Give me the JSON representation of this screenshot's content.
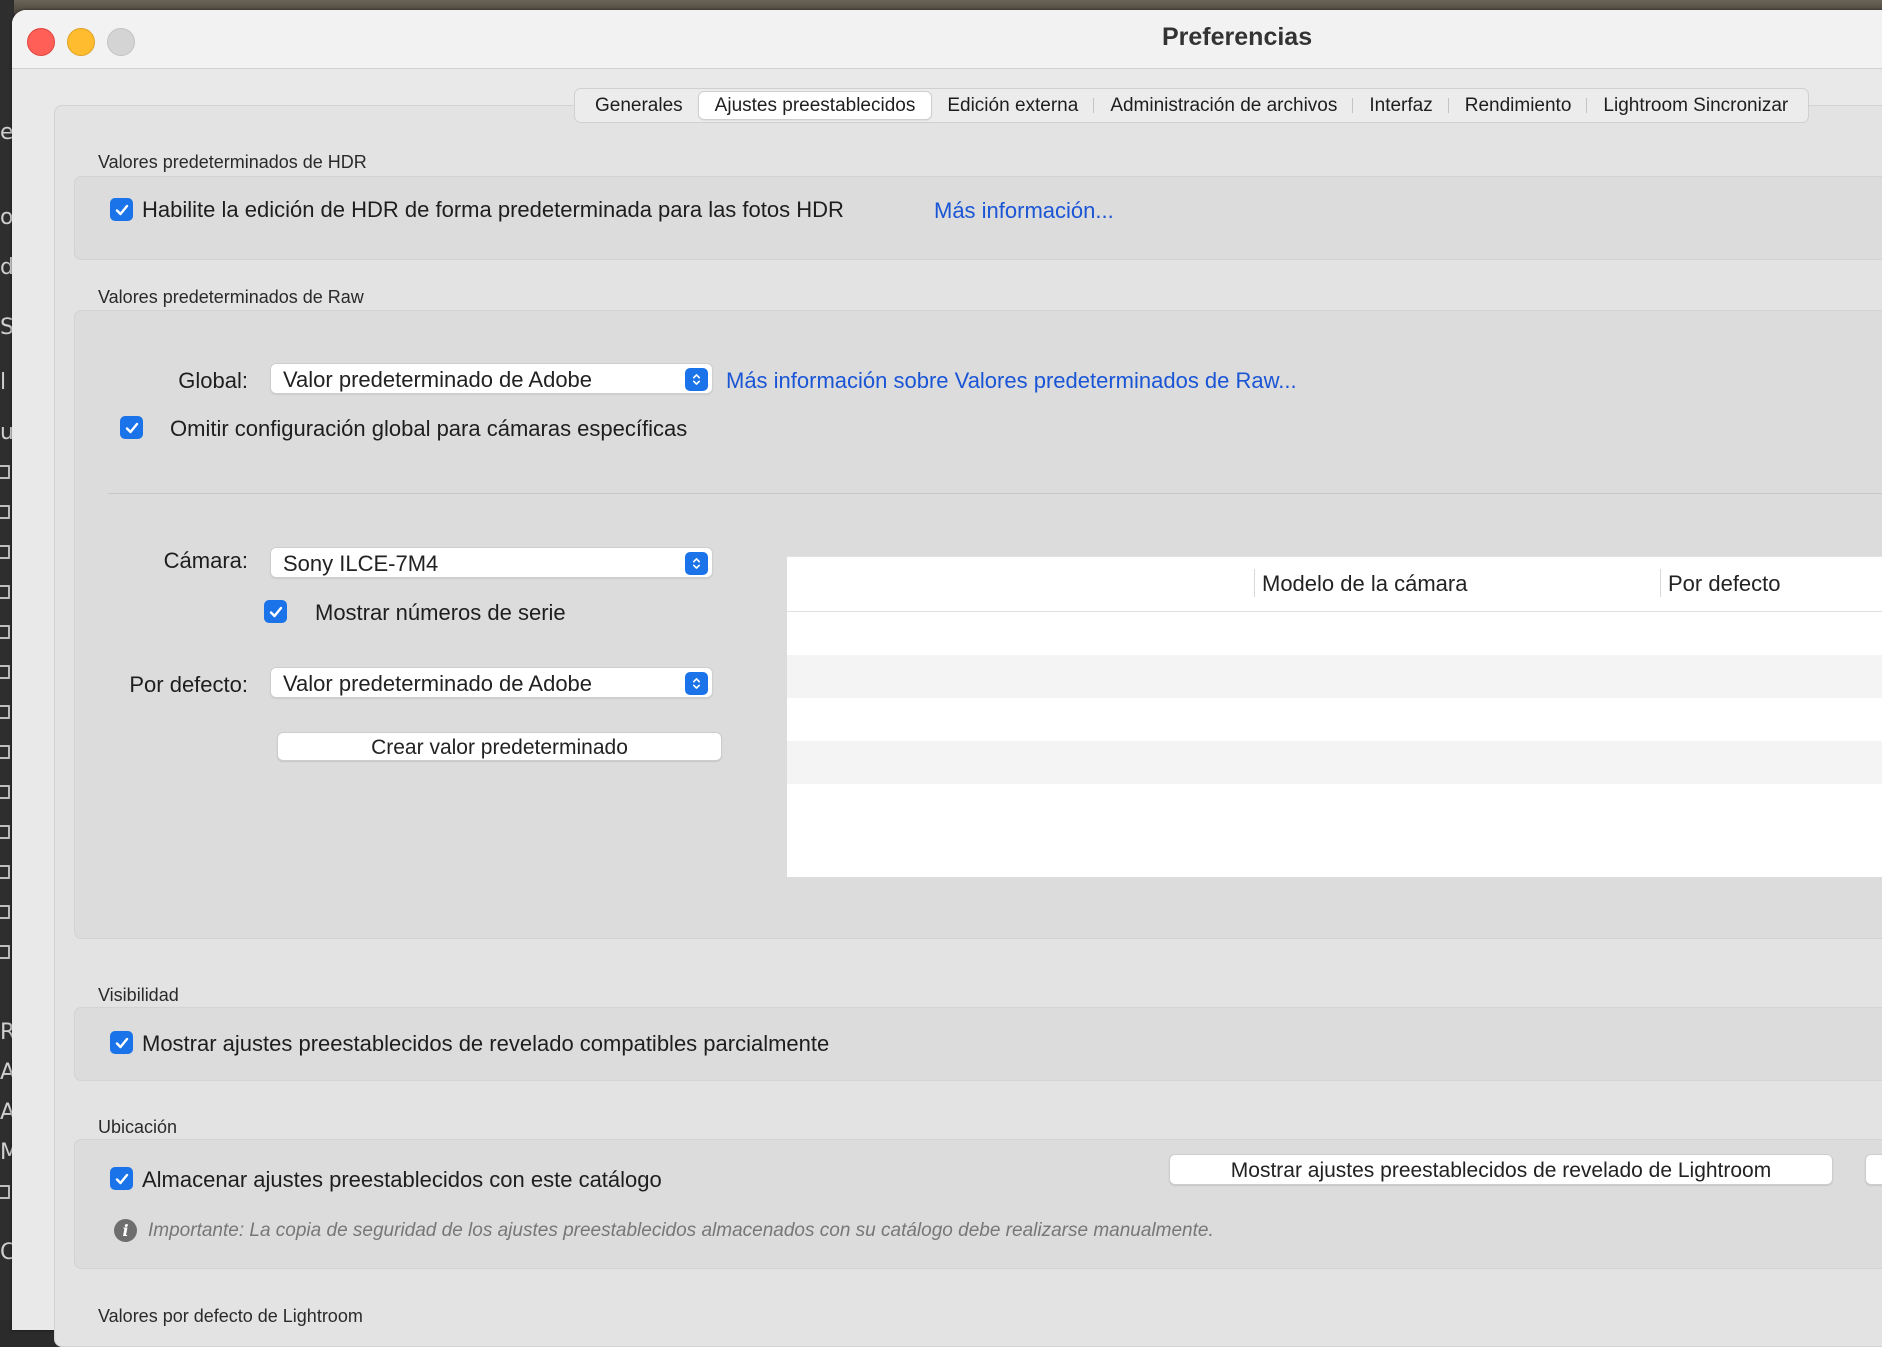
{
  "window": {
    "title": "Preferencias"
  },
  "tabs": [
    {
      "label": "Generales",
      "active": false
    },
    {
      "label": "Ajustes preestablecidos",
      "active": true
    },
    {
      "label": "Edición externa",
      "active": false
    },
    {
      "label": "Administración de archivos",
      "active": false
    },
    {
      "label": "Interfaz",
      "active": false
    },
    {
      "label": "Rendimiento",
      "active": false
    },
    {
      "label": "Lightroom Sincronizar",
      "active": false
    }
  ],
  "hdr": {
    "section_label": "Valores predeterminados de HDR",
    "checkbox_label": "Habilite la edición de HDR de forma predeterminada para las fotos HDR",
    "checked": true,
    "link": "Más información..."
  },
  "raw": {
    "section_label": "Valores predeterminados de Raw",
    "global_label": "Global:",
    "global_value": "Valor predeterminado de Adobe",
    "global_link": "Más información sobre Valores predeterminados de Raw...",
    "override_label": "Omitir configuración global para cámaras específicas",
    "override_checked": true,
    "camera_label": "Cámara:",
    "camera_value": "Sony ILCE-7M4",
    "serial_label": "Mostrar números de serie",
    "serial_checked": true,
    "default_label": "Por defecto:",
    "default_value": "Valor predeterminado de Adobe",
    "create_button": "Crear valor predeterminado",
    "table": {
      "columns": [
        "Modelo de la cámara",
        "Por defecto"
      ],
      "rows": []
    }
  },
  "visibility": {
    "section_label": "Visibilidad",
    "checkbox_label": "Mostrar ajustes preestablecidos de revelado compatibles parcialmente",
    "checked": true
  },
  "location": {
    "section_label": "Ubicación",
    "checkbox_label": "Almacenar ajustes preestablecidos con este catálogo",
    "checked": true,
    "show_button": "Mostrar ajustes preestablecidos de revelado de Lightroom",
    "note": "Importante: La copia de seguridad de los ajustes preestablecidos almacenados con su catálogo debe realizarse manualmente."
  },
  "lightroom_defaults": {
    "section_label": "Valores por defecto de Lightroom"
  },
  "colors": {
    "accent": "#1a73e8",
    "link": "#1a55d6",
    "panel": "#e3e3e3"
  }
}
